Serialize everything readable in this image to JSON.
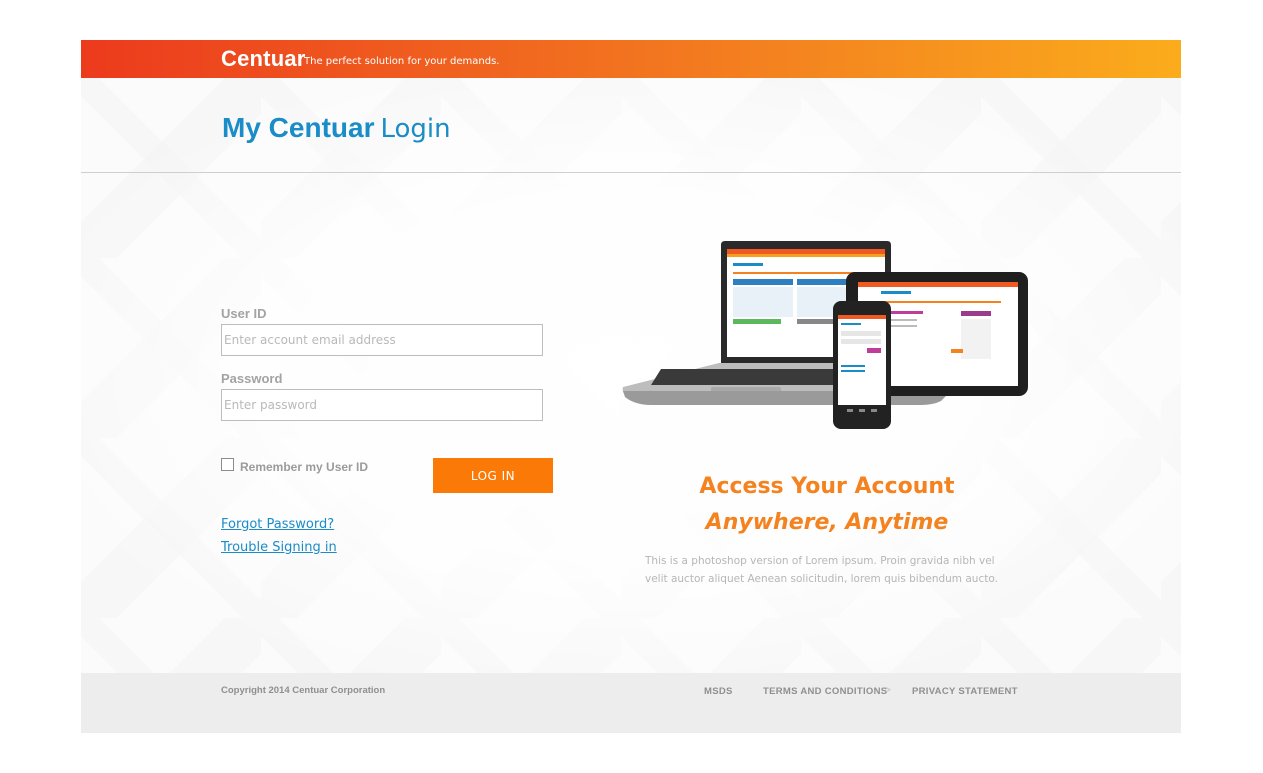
{
  "header": {
    "brand": "Centuar",
    "tagline": "The perfect solution for your demands."
  },
  "title": {
    "strong": "My Centuar",
    "light": "Login"
  },
  "form": {
    "user_label": "User ID",
    "user_placeholder": "Enter account email address",
    "password_label": "Password",
    "password_placeholder": "Enter password",
    "remember_label": "Remember my User ID",
    "remember_checked": false,
    "login_button": "LOG IN",
    "forgot_link": "Forgot Password?",
    "trouble_link": "Trouble Signing in"
  },
  "promo": {
    "title": "Access Your Account",
    "subtitle": "Anywhere, Anytime",
    "description": "This is a photoshop version of Lorem ipsum. Proin gravida nibh vel velit auctor aliquet Aenean solicitudin, lorem quis bibendum aucto."
  },
  "footer": {
    "copyright": "Copyright 2014 Centuar Corporation",
    "links": [
      "MSDS",
      "TERMS AND CONDITIONS",
      "PRIVACY STATEMENT"
    ],
    "separator": ">"
  },
  "colors": {
    "accent_blue": "#1a8cc7",
    "accent_orange": "#fb7a07",
    "header_gradient_start": "#ec3a1d",
    "header_gradient_end": "#fbac1c"
  },
  "icons": {
    "devices_illustration": "laptop-tablet-phone-illustration"
  }
}
